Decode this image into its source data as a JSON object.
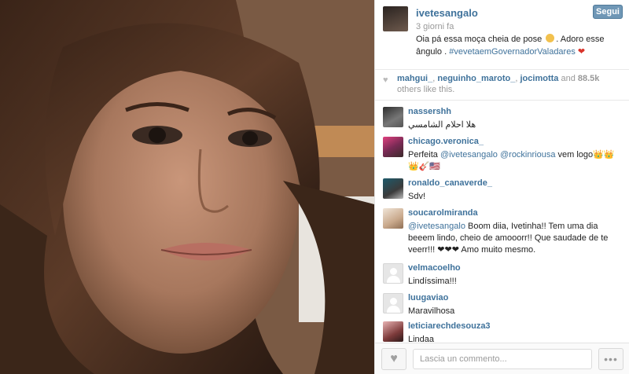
{
  "post": {
    "username": "ivetesangalo",
    "time": "3 giorni fa",
    "follow_label": "Segui",
    "caption_text": "Oia pá essa moça cheia de pose",
    "caption_text2": ". Adoro esse ângulo .",
    "hashtag": "#vevetaemGovernadorValadares"
  },
  "likes": {
    "users": [
      "mahgui_",
      "neguinho_maroto_",
      "jocimotta"
    ],
    "and": "and",
    "count": "88.5k",
    "suffix": "others like this."
  },
  "comments": [
    {
      "user": "nassershh",
      "text": "هلا احلام الشامسي"
    },
    {
      "user": "chicago.veronica_",
      "prefix": "Perfeita",
      "mention1": "@ivetesangalo",
      "mention2": "@rockinriousa",
      "suffix": "vem logo"
    },
    {
      "user": "ronaldo_canaverde_",
      "text": "Sdv!"
    },
    {
      "user": "soucarolmiranda",
      "mention": "@ivetesangalo",
      "text": "Boom diia, Ivetinha!! Tem uma dia beeem lindo, cheio de amooorr!! Que saudade de te veerr!!!",
      "hearts": "❤❤❤",
      "tail": "Amo muito mesmo."
    },
    {
      "user": "velmacoelho",
      "text": "Lindíssima!!!"
    },
    {
      "user": "luugaviao",
      "text": "Maravilhosa"
    },
    {
      "user": "leticiarechdesouza3",
      "text": "Lindaa"
    }
  ],
  "footer": {
    "comment_placeholder": "Lascia un commento...",
    "more_label": "•••"
  },
  "icons": {
    "like": "heart-icon",
    "more": "more-dots-icon"
  }
}
